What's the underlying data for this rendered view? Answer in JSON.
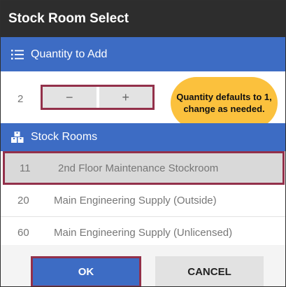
{
  "dialog": {
    "title": "Stock Room Select"
  },
  "quantity": {
    "header_label": "Quantity to Add",
    "header_icon": "list-icon",
    "value": "2",
    "decrement_label": "−",
    "increment_label": "+",
    "callout": "Quantity defaults to 1, change as needed."
  },
  "stock_rooms": {
    "header_label": "Stock Rooms",
    "header_icon": "boxes-icon",
    "items": [
      {
        "code": "11",
        "name": "2nd Floor Maintenance Stockroom",
        "selected": true
      },
      {
        "code": "20",
        "name": "Main Engineering Supply (Outside)",
        "selected": false
      },
      {
        "code": "60",
        "name": "Main Engineering Supply (Unlicensed)",
        "selected": false
      }
    ]
  },
  "actions": {
    "ok_label": "OK",
    "cancel_label": "CANCEL"
  },
  "colors": {
    "titlebar": "#2d2d2d",
    "section_header": "#3d6cc4",
    "highlight_border": "#93304a",
    "callout": "#fbc13d"
  }
}
